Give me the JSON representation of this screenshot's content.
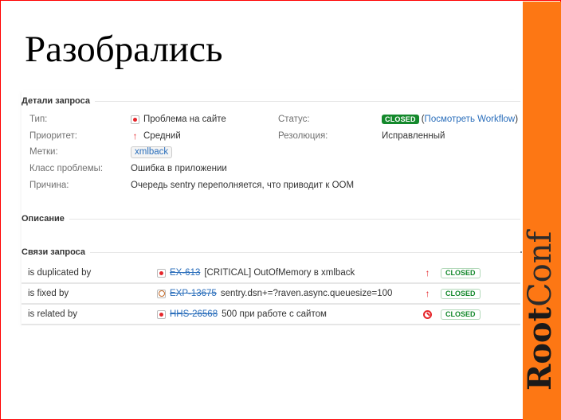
{
  "slide": {
    "title": "Разобрались",
    "brand_bold": "Root",
    "brand_light": "Conf",
    "colors": {
      "frame": "#ff0000",
      "brand": "#fd7714"
    }
  },
  "details": {
    "heading": "Детали запроса",
    "type_label": "Тип:",
    "type_value": "Проблема на сайте",
    "type_icon": "bug-icon",
    "priority_label": "Приоритет:",
    "priority_value": "Средний",
    "priority_icon": "arrow-up-icon",
    "labels_label": "Метки:",
    "labels_value": "xmlback",
    "class_label": "Класс проблемы:",
    "class_value": "Ошибка в приложении",
    "cause_label": "Причина:",
    "cause_value": "Очередь sentry переполняется, что приводит к OOM",
    "status_label": "Статус:",
    "status_value": "CLOSED",
    "status_link_open": "(",
    "status_link": "Посмотреть Workflow",
    "status_link_close": ")",
    "resolution_label": "Резолюция:",
    "resolution_value": "Исправленный",
    "colors": {
      "status": "#14892c",
      "link": "#2a6ebb",
      "priority": "#e5262b"
    }
  },
  "description": {
    "heading": "Описание"
  },
  "issue_links": {
    "heading": "Связи запроса",
    "rows": [
      {
        "relation": "is duplicated by",
        "icon": "bug-icon",
        "key": "EX-613",
        "summary": "[CRITICAL] OutOfMemory в xmlback",
        "priority_icon": "arrow-up-icon",
        "status": "CLOSED"
      },
      {
        "relation": "is fixed by",
        "icon": "task-icon",
        "key": "EXP-13675",
        "summary": "sentry.dsn+=?raven.async.queuesize=100",
        "priority_icon": "arrow-up-icon",
        "status": "CLOSED"
      },
      {
        "relation": "is related by",
        "icon": "bug-icon",
        "key": "HHS-26568",
        "summary": "500 при работе с сайтом",
        "priority_icon": "blocker-icon",
        "status": "CLOSED"
      }
    ]
  }
}
